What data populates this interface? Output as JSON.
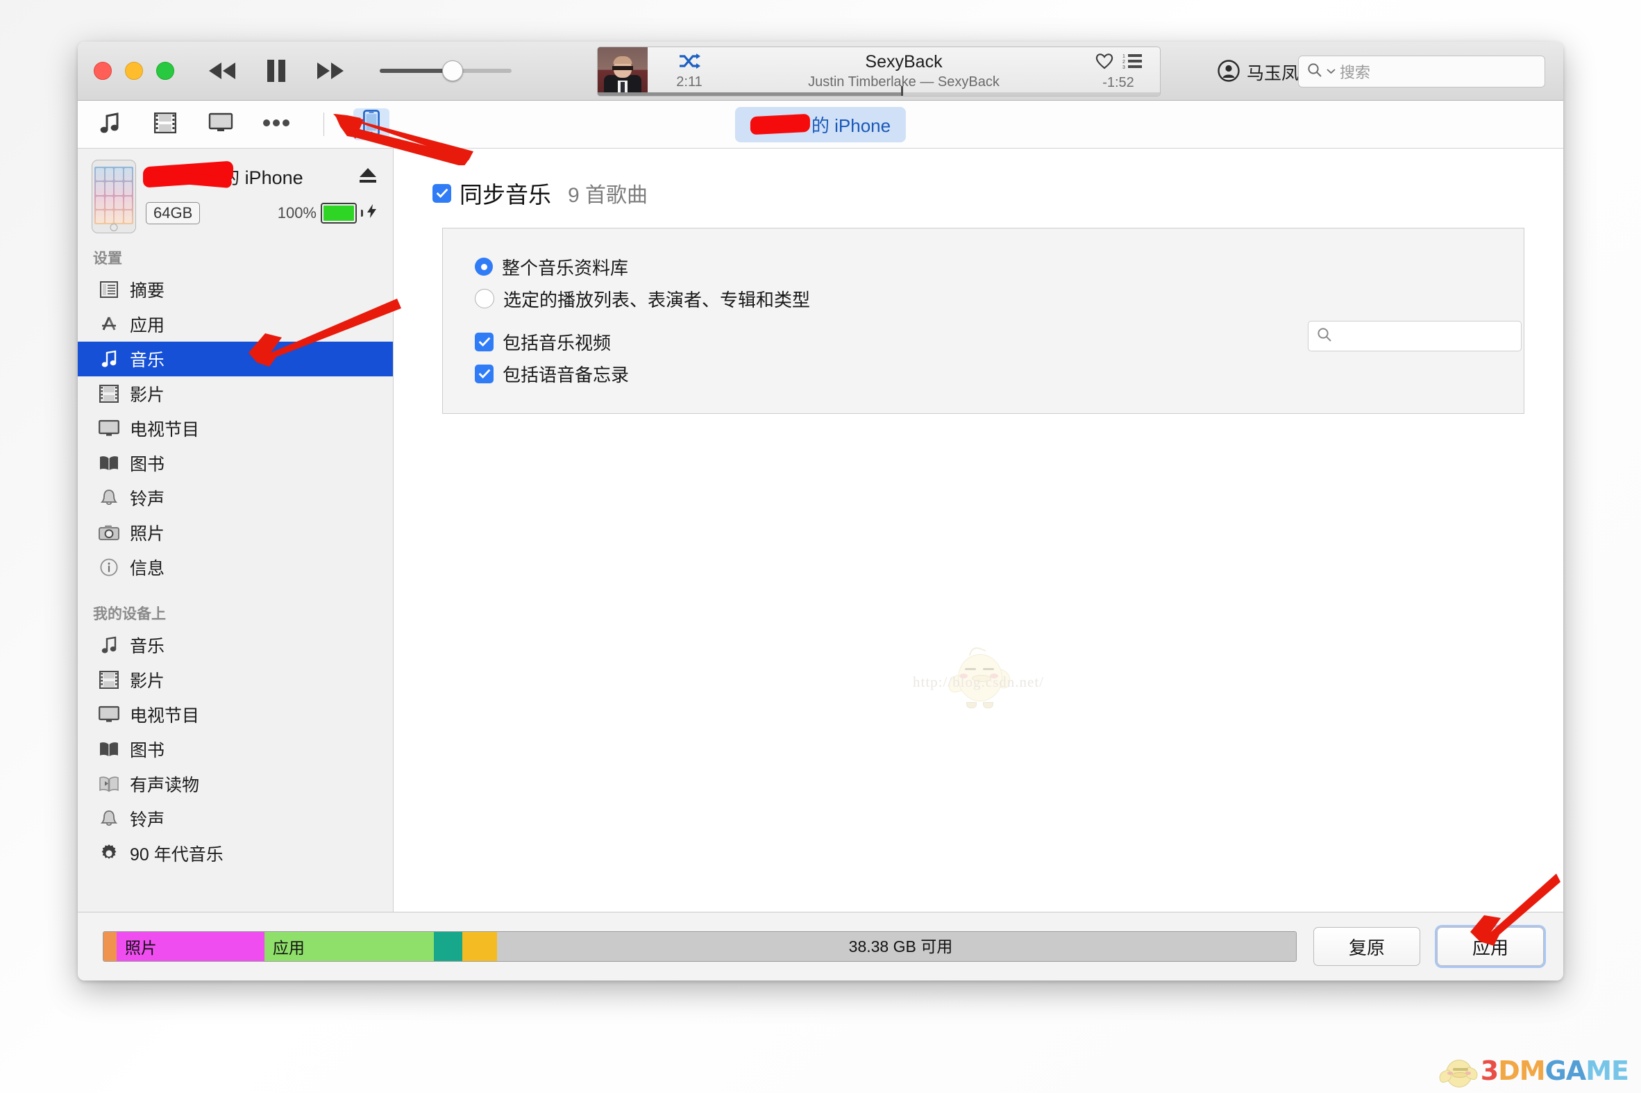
{
  "window": {
    "traffic_lights": [
      "close",
      "minimize",
      "maximize"
    ]
  },
  "player": {
    "elapsed": "2:11",
    "remaining": "-1:52",
    "track_title": "SexyBack",
    "track_subtitle": "Justin Timberlake — SexyBack",
    "shuffle_icon": "shuffle-icon",
    "love_icon": "heart-icon",
    "upnext_icon": "up-next-list-icon",
    "rewind_icon": "rewind-icon",
    "pause_icon": "pause-icon",
    "forward_icon": "fast-forward-icon",
    "volume_percent": 55,
    "progress_percent": 54,
    "artwork_alt": "album-artwork"
  },
  "account": {
    "name": "马玉凤",
    "avatar_icon": "user-avatar-icon",
    "chevron_icon": "chevron-down-icon"
  },
  "search": {
    "placeholder": "搜索",
    "value": "",
    "icon": "search-icon",
    "chevron_icon": "chevron-down-icon"
  },
  "toolbar": {
    "icons": [
      {
        "name": "music-icon",
        "label": "音乐"
      },
      {
        "name": "movies-film-icon",
        "label": "影片"
      },
      {
        "name": "tv-shows-icon",
        "label": "电视节目"
      },
      {
        "name": "more-ellipsis-icon",
        "label": "更多"
      }
    ],
    "device_button_icon": "iphone-device-icon",
    "device_pill_suffix": "的 iPhone",
    "device_pill_redacted": true
  },
  "sidebar": {
    "device": {
      "name_suffix": "的 iPhone",
      "name_redacted": true,
      "capacity": "64GB",
      "battery_percent": "100%",
      "battery_icon": "battery-icon",
      "charging_icon": "lightning-bolt-icon",
      "eject_icon": "eject-icon",
      "thumbnail": "iphone-thumbnail"
    },
    "sections": [
      {
        "title": "设置",
        "items": [
          {
            "label": "摘要",
            "icon": "summary-icon",
            "selected": false
          },
          {
            "label": "应用",
            "icon": "app-store-icon",
            "selected": false
          },
          {
            "label": "音乐",
            "icon": "music-note-icon",
            "selected": true
          },
          {
            "label": "影片",
            "icon": "film-icon",
            "selected": false
          },
          {
            "label": "电视节目",
            "icon": "tv-icon",
            "selected": false
          },
          {
            "label": "图书",
            "icon": "book-icon",
            "selected": false
          },
          {
            "label": "铃声",
            "icon": "bell-icon",
            "selected": false
          },
          {
            "label": "照片",
            "icon": "camera-icon",
            "selected": false
          },
          {
            "label": "信息",
            "icon": "info-circle-icon",
            "selected": false
          }
        ]
      },
      {
        "title": "我的设备上",
        "items": [
          {
            "label": "音乐",
            "icon": "music-note-icon",
            "selected": false
          },
          {
            "label": "影片",
            "icon": "film-icon",
            "selected": false
          },
          {
            "label": "电视节目",
            "icon": "tv-icon",
            "selected": false
          },
          {
            "label": "图书",
            "icon": "book-icon",
            "selected": false
          },
          {
            "label": "有声读物",
            "icon": "audiobook-icon",
            "selected": false
          },
          {
            "label": "铃声",
            "icon": "bell-icon",
            "selected": false
          },
          {
            "label": "90 年代音乐",
            "icon": "gear-playlist-icon",
            "selected": false
          }
        ]
      }
    ]
  },
  "main": {
    "sync_checkbox_checked": true,
    "sync_label": "同步音乐",
    "sync_count": "9 首歌曲",
    "search_placeholder": "",
    "search_icon": "search-icon",
    "options": {
      "radio_selected_index": 0,
      "radios": [
        "整个音乐资料库",
        "选定的播放列表、表演者、专辑和类型"
      ],
      "checkboxes": [
        {
          "label": "包括音乐视频",
          "checked": true
        },
        {
          "label": "包括语音备忘录",
          "checked": true
        }
      ]
    },
    "watermark_url": "http://blog.csdn.net/"
  },
  "footer": {
    "capacity_segments": [
      {
        "label": "",
        "color": "#f0934e",
        "percent": 1.1
      },
      {
        "label": "照片",
        "color": "#ef4df0",
        "percent": 12.4
      },
      {
        "label": "应用",
        "color": "#8fe06a",
        "percent": 14.2
      },
      {
        "label": "",
        "color": "#17a88b",
        "percent": 2.4
      },
      {
        "label": "",
        "color": "#f5bb23",
        "percent": 2.9
      },
      {
        "label": "",
        "color": "#cacaca",
        "percent": 67.0
      }
    ],
    "free_space": "38.38 GB 可用",
    "restore_label": "复原",
    "apply_label": "应用"
  },
  "overlay": {
    "arrows": [
      {
        "name": "arrow-to-device-tab"
      },
      {
        "name": "arrow-to-music-sidebar"
      },
      {
        "name": "arrow-to-apply-button"
      }
    ],
    "logo": {
      "text_parts": [
        "3",
        "DM",
        "GA",
        "ME"
      ],
      "colors": [
        "#e8453c",
        "#f2a33c",
        "#4a9ad4",
        "#6fc3e8"
      ]
    }
  }
}
